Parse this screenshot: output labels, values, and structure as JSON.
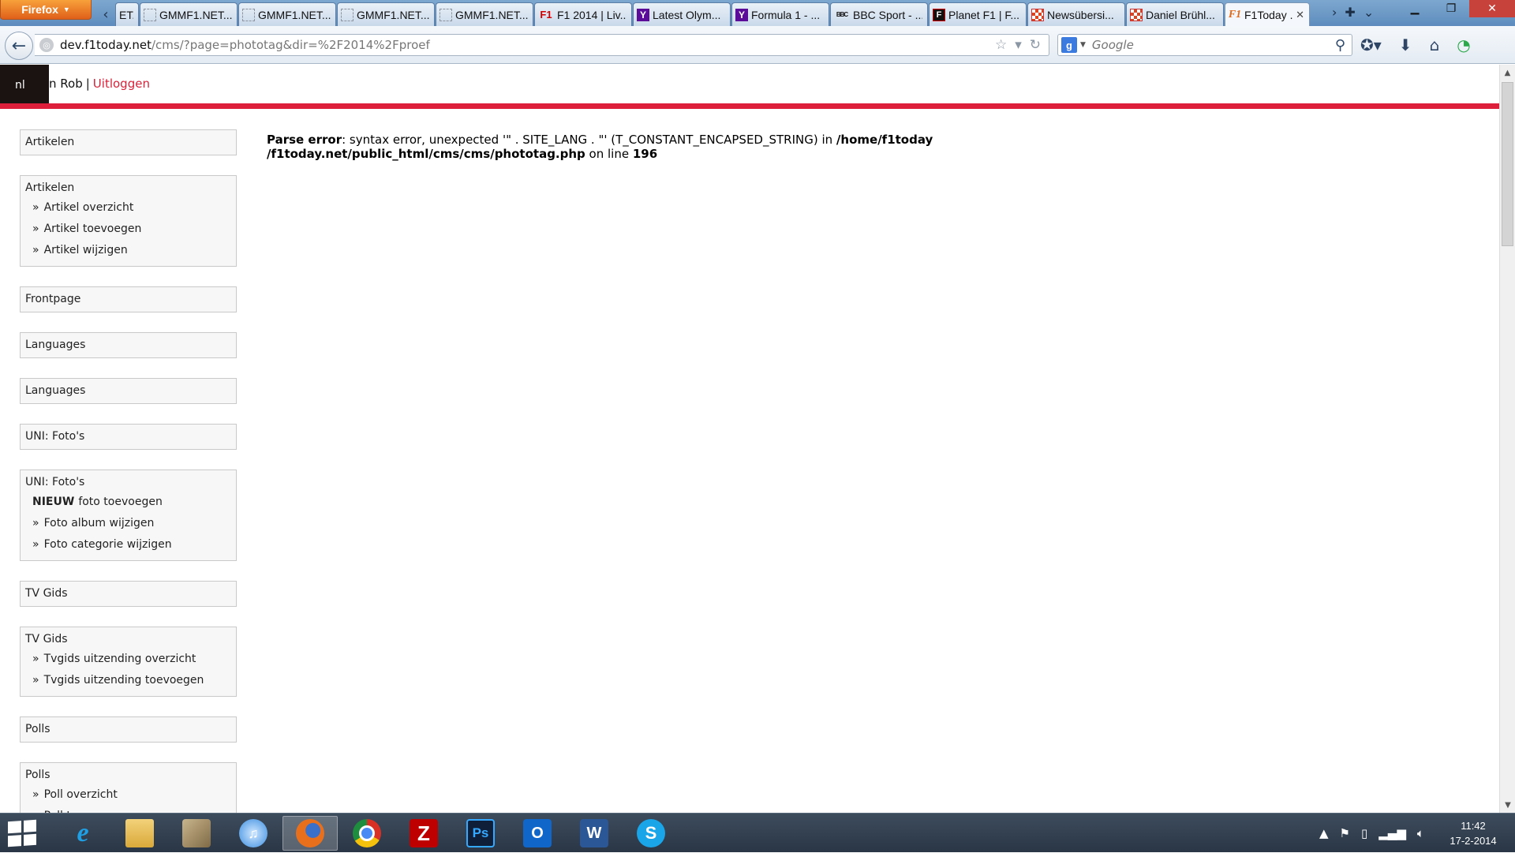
{
  "browser": {
    "app_button": "Firefox",
    "tabs": [
      {
        "label": "ET...",
        "icon": "blank",
        "active": false
      },
      {
        "label": "GMMF1.NET...",
        "icon": "page",
        "active": false
      },
      {
        "label": "GMMF1.NET...",
        "icon": "page",
        "active": false
      },
      {
        "label": "GMMF1.NET...",
        "icon": "page",
        "active": false
      },
      {
        "label": "GMMF1.NET...",
        "icon": "page",
        "active": false
      },
      {
        "label": "F1 2014 | Liv...",
        "icon": "f1",
        "active": false
      },
      {
        "label": "Latest Olym...",
        "icon": "yahoo",
        "active": false
      },
      {
        "label": "Formula 1 - ...",
        "icon": "yahoo",
        "active": false
      },
      {
        "label": "BBC Sport - ...",
        "icon": "bbc",
        "active": false
      },
      {
        "label": "Planet F1 | F...",
        "icon": "planet",
        "active": false
      },
      {
        "label": "Newsübersi...",
        "icon": "checker",
        "active": false
      },
      {
        "label": "Daniel Brühl...",
        "icon": "checker",
        "active": false
      },
      {
        "label": "F1Today ...",
        "icon": "f1today",
        "active": true
      }
    ],
    "favicon_text": {
      "f1": "F1",
      "yahoo": "Y",
      "bbc": "BBC",
      "planet": "F",
      "f1today": "F1"
    },
    "url": {
      "host": "dev.f1today.net",
      "path": "/cms/?page=phototag&dir=%2F2014%2Fproef"
    },
    "search": {
      "engine_letter": "g",
      "placeholder": "Google"
    }
  },
  "page": {
    "lang": "nl",
    "user_prefix": "n Rob",
    "separator": "|",
    "logout": "Uitloggen",
    "error": {
      "label": "Parse error",
      "message": ": syntax error, unexpected '\" . SITE_LANG . \"' (T_CONSTANT_ENCAPSED_STRING) in ",
      "path": "/home/f1today /f1today.net/public_html/cms/cms/phototag.php",
      "line_text": " on line ",
      "line": "196"
    },
    "sidebar": [
      {
        "title": "Artikelen",
        "items": []
      },
      {
        "title": "Artikelen",
        "items": [
          {
            "text": "Artikel overzicht"
          },
          {
            "text": "Artikel toevoegen"
          },
          {
            "text": "Artikel wijzigen"
          }
        ]
      },
      {
        "title": "Frontpage",
        "items": []
      },
      {
        "title": "Languages",
        "items": []
      },
      {
        "title": "Languages",
        "items": []
      },
      {
        "title": "UNI: Foto's",
        "items": []
      },
      {
        "title": "UNI: Foto's",
        "items": [
          {
            "strong": "NIEUW",
            "text": "foto toevoegen"
          },
          {
            "text": "Foto album wijzigen"
          },
          {
            "text": "Foto categorie wijzigen"
          }
        ]
      },
      {
        "title": "TV Gids",
        "items": []
      },
      {
        "title": "TV Gids",
        "items": [
          {
            "text": "Tvgids uitzending overzicht"
          },
          {
            "text": "Tvgids uitzending toevoegen"
          }
        ]
      },
      {
        "title": "Polls",
        "items": []
      },
      {
        "title": "Polls",
        "items": [
          {
            "text": "Poll overzicht"
          },
          {
            "text": "Poll toevoegen"
          }
        ]
      }
    ]
  },
  "taskbar": {
    "apps": [
      {
        "name": "ie",
        "glyph": "e",
        "active": false
      },
      {
        "name": "explorer",
        "glyph": "",
        "active": false
      },
      {
        "name": "app3",
        "glyph": "",
        "active": false
      },
      {
        "name": "itunes",
        "glyph": "♫",
        "active": false
      },
      {
        "name": "firefox",
        "glyph": "",
        "active": true
      },
      {
        "name": "chrome",
        "glyph": "",
        "active": false
      },
      {
        "name": "filezilla",
        "glyph": "Z",
        "active": false
      },
      {
        "name": "ps",
        "glyph": "Ps",
        "active": false
      },
      {
        "name": "outlook",
        "glyph": "O",
        "active": false
      },
      {
        "name": "word",
        "glyph": "W",
        "active": false
      },
      {
        "name": "skype",
        "glyph": "S",
        "active": false
      }
    ],
    "clock": {
      "time": "11:42",
      "date": "17-2-2014"
    }
  }
}
